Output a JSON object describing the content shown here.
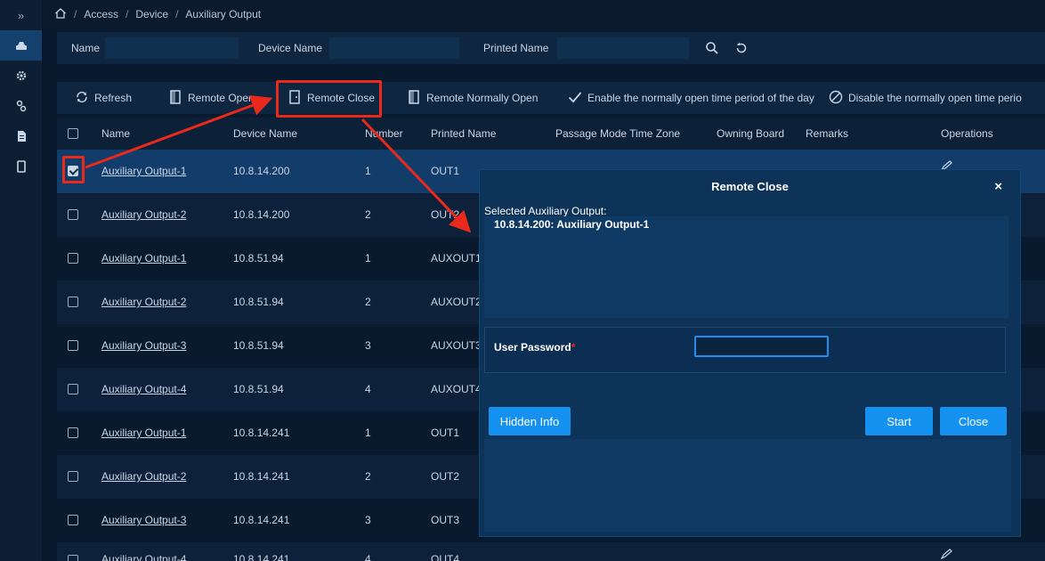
{
  "breadcrumb": {
    "sep": "/",
    "items": [
      "Access",
      "Device",
      "Auxiliary Output"
    ]
  },
  "search": {
    "name_label": "Name",
    "device_name_label": "Device Name",
    "printed_name_label": "Printed Name"
  },
  "toolbar": {
    "refresh": "Refresh",
    "remote_open": "Remote Open",
    "remote_close": "Remote Close",
    "remote_normally_open": "Remote Normally Open",
    "enable_np": "Enable the normally open time period of the day",
    "disable_np": "Disable the normally open time perio"
  },
  "table": {
    "headers": {
      "name": "Name",
      "device_name": "Device Name",
      "number": "Number",
      "printed_name": "Printed Name",
      "passage_mode": "Passage Mode Time Zone",
      "owning_board": "Owning Board",
      "remarks": "Remarks",
      "operations": "Operations"
    },
    "rows": [
      {
        "name": "Auxiliary Output-1",
        "device": "10.8.14.200",
        "number": "1",
        "printed": "OUT1"
      },
      {
        "name": "Auxiliary Output-2",
        "device": "10.8.14.200",
        "number": "2",
        "printed": "OUT2"
      },
      {
        "name": "Auxiliary Output-1",
        "device": "10.8.51.94",
        "number": "1",
        "printed": "AUXOUT1"
      },
      {
        "name": "Auxiliary Output-2",
        "device": "10.8.51.94",
        "number": "2",
        "printed": "AUXOUT2"
      },
      {
        "name": "Auxiliary Output-3",
        "device": "10.8.51.94",
        "number": "3",
        "printed": "AUXOUT3"
      },
      {
        "name": "Auxiliary Output-4",
        "device": "10.8.51.94",
        "number": "4",
        "printed": "AUXOUT4"
      },
      {
        "name": "Auxiliary Output-1",
        "device": "10.8.14.241",
        "number": "1",
        "printed": "OUT1"
      },
      {
        "name": "Auxiliary Output-2",
        "device": "10.8.14.241",
        "number": "2",
        "printed": "OUT2"
      },
      {
        "name": "Auxiliary Output-3",
        "device": "10.8.14.241",
        "number": "3",
        "printed": "OUT3"
      },
      {
        "name": "Auxiliary Output-4",
        "device": "10.8.14.241",
        "number": "4",
        "printed": "OUT4"
      }
    ]
  },
  "dialog": {
    "title": "Remote Close",
    "close_x": "×",
    "selected_label": "Selected Auxiliary Output:",
    "selected_item": "10.8.14.200:  Auxiliary Output-1",
    "password_label": "User Password",
    "required_mark": "*",
    "hidden_info": "Hidden Info",
    "start": "Start",
    "close": "Close"
  },
  "colors": {
    "accent": "#1591f0",
    "annotation": "#e8291c",
    "selected_row": "#123d6b",
    "background": "#0a1a2e"
  }
}
